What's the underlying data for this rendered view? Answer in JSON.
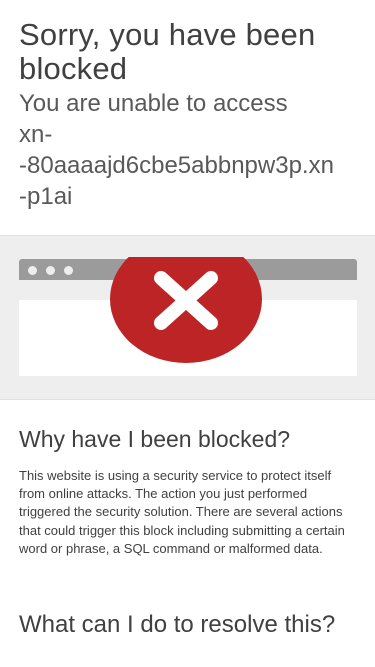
{
  "header": {
    "title": "Sorry, you have been blocked",
    "subtitle": "You are unable to access\nxn-\n-80aaaajd6cbe5abbnpw3p.xn\n-p1ai"
  },
  "illustration": {
    "icon": "error-x-icon",
    "colors": {
      "circle": "#bd2426",
      "x": "#ffffff",
      "bar": "#9b9b9b",
      "background": "#eeeeee"
    }
  },
  "why": {
    "heading": "Why have I been blocked?",
    "body": "This website is using a security service to protect itself from online attacks. The action you just performed triggered the security solution. There are several actions that could trigger this block including submitting a certain word or phrase, a SQL command or malformed data."
  },
  "resolve": {
    "heading": "What can I do to resolve this?"
  }
}
